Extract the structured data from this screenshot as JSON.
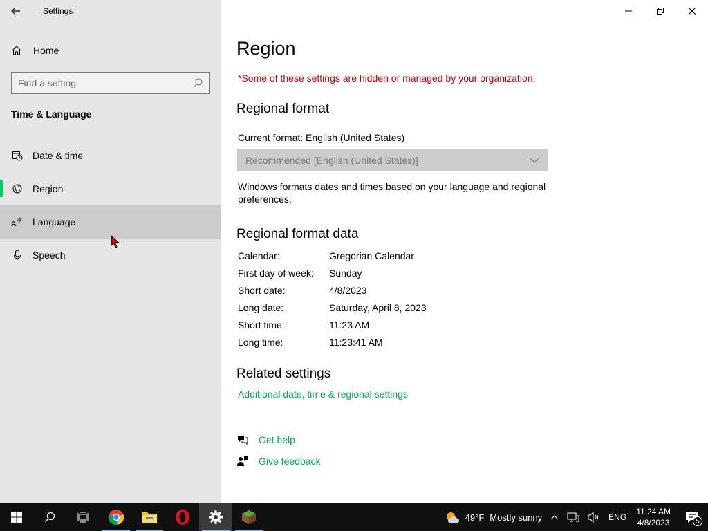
{
  "window": {
    "app_title": "Settings"
  },
  "sidebar": {
    "home_label": "Home",
    "search_placeholder": "Find a setting",
    "section_title": "Time & Language",
    "items": [
      {
        "label": "Date & time",
        "icon": "date-time-icon"
      },
      {
        "label": "Region",
        "icon": "region-icon",
        "selected": true
      },
      {
        "label": "Language",
        "icon": "language-icon",
        "hover": true
      },
      {
        "label": "Speech",
        "icon": "microphone-icon"
      }
    ]
  },
  "main": {
    "title": "Region",
    "org_notice": "*Some of these settings are hidden or managed by your organization.",
    "regional_format": {
      "header": "Regional format",
      "current_format": "Current format: English (United States)",
      "dropdown_value": "Recommended [English (United States)]",
      "description": "Windows formats dates and times based on your language and regional preferences."
    },
    "format_data": {
      "header": "Regional format data",
      "rows": [
        {
          "key": "Calendar:",
          "value": "Gregorian Calendar"
        },
        {
          "key": "First day of week:",
          "value": "Sunday"
        },
        {
          "key": "Short date:",
          "value": "4/8/2023"
        },
        {
          "key": "Long date:",
          "value": "Saturday, April 8, 2023"
        },
        {
          "key": "Short time:",
          "value": "11:23 AM"
        },
        {
          "key": "Long time:",
          "value": "11:23:41 AM"
        }
      ]
    },
    "related": {
      "header": "Related settings",
      "link": "Additional date, time & regional settings"
    },
    "help": {
      "get_help": "Get help",
      "give_feedback": "Give feedback"
    }
  },
  "taskbar": {
    "weather_temp": "49°F",
    "weather_desc": "Mostly sunny",
    "language": "ENG",
    "time": "11:24 AM",
    "date": "4/8/2023",
    "notification_count": "5"
  },
  "colors": {
    "accent": "#00cc6a",
    "link": "#00a854",
    "warning": "#c50500",
    "sidebar_bg": "#e6e6e6",
    "taskbar_bg": "#101010"
  }
}
